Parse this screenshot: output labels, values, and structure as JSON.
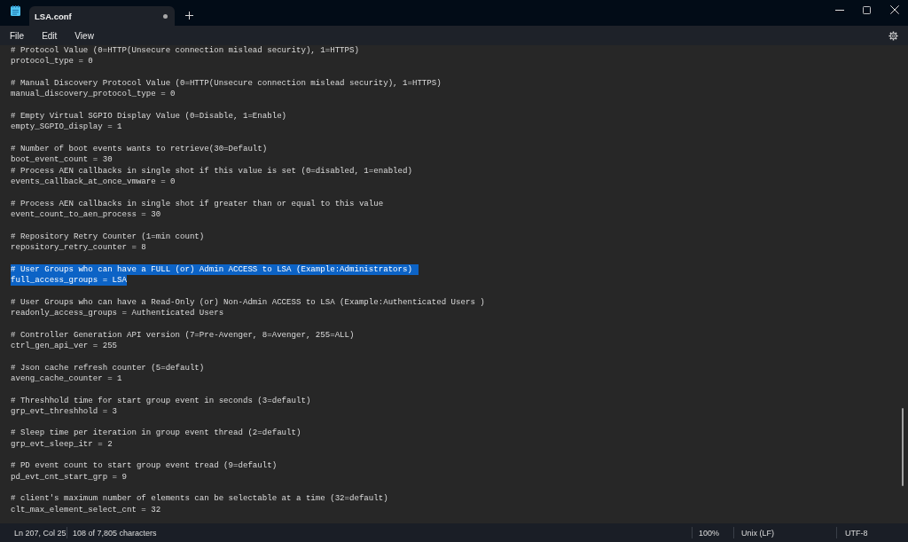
{
  "tabs": [
    {
      "label": "LSA.conf",
      "selected": true,
      "modified": true
    }
  ],
  "menu": [
    "File",
    "Edit",
    "View"
  ],
  "editor": {
    "blocks": [
      {
        "lines": [
          {
            "text": "# Protocol Value (0=HTTP(Unsecure connection mislead security), 1=HTTPS)",
            "selected": false
          },
          {
            "text": "protocol_type = 0",
            "selected": false
          }
        ]
      },
      {
        "lines": [
          {
            "text": "# Manual Discovery Protocol Value (0=HTTP(Unsecure connection mislead security), 1=HTTPS)",
            "selected": false
          },
          {
            "text": "manual_discovery_protocol_type = 0",
            "selected": false
          }
        ]
      },
      {
        "lines": [
          {
            "text": "# Empty Virtual SGPIO Display Value (0=Disable, 1=Enable)",
            "selected": false
          },
          {
            "text": "empty_SGPIO_display = 1",
            "selected": false
          }
        ]
      },
      {
        "lines": [
          {
            "text": "# Number of boot events wants to retrieve(30=Default)",
            "selected": false
          },
          {
            "text": "boot_event_count = 30",
            "selected": false
          },
          {
            "text": "# Process AEN callbacks in single shot if this value is set (0=disabled, 1=enabled)",
            "selected": false
          },
          {
            "text": "events_callback_at_once_vmware = 0",
            "selected": false
          }
        ]
      },
      {
        "lines": [
          {
            "text": "# Process AEN callbacks in single shot if greater than or equal to this value",
            "selected": false
          },
          {
            "text": "event_count_to_aen_process = 30",
            "selected": false
          }
        ]
      },
      {
        "lines": [
          {
            "text": "# Repository Retry Counter (1=min count)",
            "selected": false
          },
          {
            "text": "repository_retry_counter = 8",
            "selected": false
          }
        ]
      },
      {
        "lines": [
          {
            "text": "# User Groups who can have a FULL (or) Admin ACCESS to LSA (Example:Administrators)",
            "selected": true
          },
          {
            "text": "full_access_groups = LSA",
            "selected": true
          }
        ]
      },
      {
        "lines": [
          {
            "text": "# User Groups who can have a Read-Only (or) Non-Admin ACCESS to LSA (Example:Authenticated Users )",
            "selected": false
          },
          {
            "text": "readonly_access_groups = Authenticated Users",
            "selected": false
          }
        ]
      },
      {
        "lines": [
          {
            "text": "# Controller Generation API version (7=Pre-Avenger, 8=Avenger, 255=ALL)",
            "selected": false
          },
          {
            "text": "ctrl_gen_api_ver = 255",
            "selected": false
          }
        ]
      },
      {
        "lines": [
          {
            "text": "# Json cache refresh counter (5=default)",
            "selected": false
          },
          {
            "text": "aveng_cache_counter = 1",
            "selected": false
          }
        ]
      },
      {
        "lines": [
          {
            "text": "# Threshhold time for start group event in seconds (3=default)",
            "selected": false
          },
          {
            "text": "grp_evt_threshhold = 3",
            "selected": false
          }
        ]
      },
      {
        "lines": [
          {
            "text": "# Sleep time per iteration in group event thread (2=default)",
            "selected": false
          },
          {
            "text": "grp_evt_sleep_itr = 2",
            "selected": false
          }
        ]
      },
      {
        "lines": [
          {
            "text": "# PD event count to start group event tread (9=default)",
            "selected": false
          },
          {
            "text": "pd_evt_cnt_start_grp = 9",
            "selected": false
          }
        ]
      },
      {
        "lines": [
          {
            "text": "# client's maximum number of elements can be selectable at a time (32=default)",
            "selected": false
          },
          {
            "text": "clt_max_element_select_cnt = 32",
            "selected": false
          }
        ]
      }
    ]
  },
  "status_bar": {
    "position": "Ln 207, Col 25",
    "character_count": "108 of 7,805 characters",
    "zoom": "100%",
    "line_ending": "Unix (LF)",
    "encoding": "UTF-8"
  }
}
